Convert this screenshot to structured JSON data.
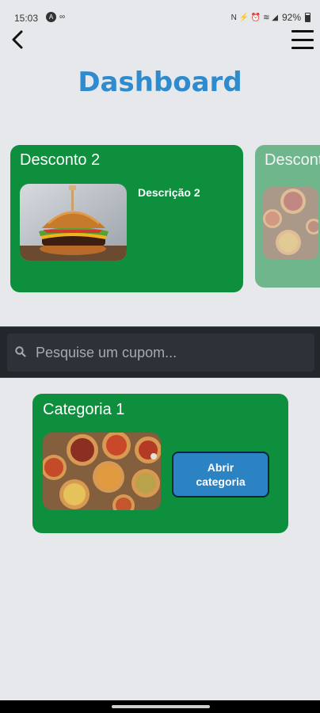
{
  "status_bar": {
    "time": "15:03",
    "app_icon_a": "A",
    "app_icon_b": "∞",
    "sys_icons": "N  ⚡  ⏰  ≋  ◢",
    "battery": "92%"
  },
  "header": {
    "title": "Dashboard"
  },
  "discounts": [
    {
      "title": "Desconto 2",
      "description": "Descrição 2",
      "image": "burger-image"
    },
    {
      "title": "Desconto",
      "description": "",
      "image": "pizza-image"
    }
  ],
  "search": {
    "placeholder": "Pesquise um cupom..."
  },
  "categories": [
    {
      "title": "Categoria 1",
      "image": "pizza-image",
      "button_label": "Abrir categoria"
    }
  ],
  "colors": {
    "accent_title": "#2e8bcd",
    "card_green": "#0e8f3e",
    "button_blue": "#2b83c3",
    "search_bar": "#22272c",
    "background": "#e6e8ec"
  },
  "icons": {
    "back": "back-arrow-icon",
    "menu": "hamburger-menu-icon",
    "search": "search-icon"
  }
}
